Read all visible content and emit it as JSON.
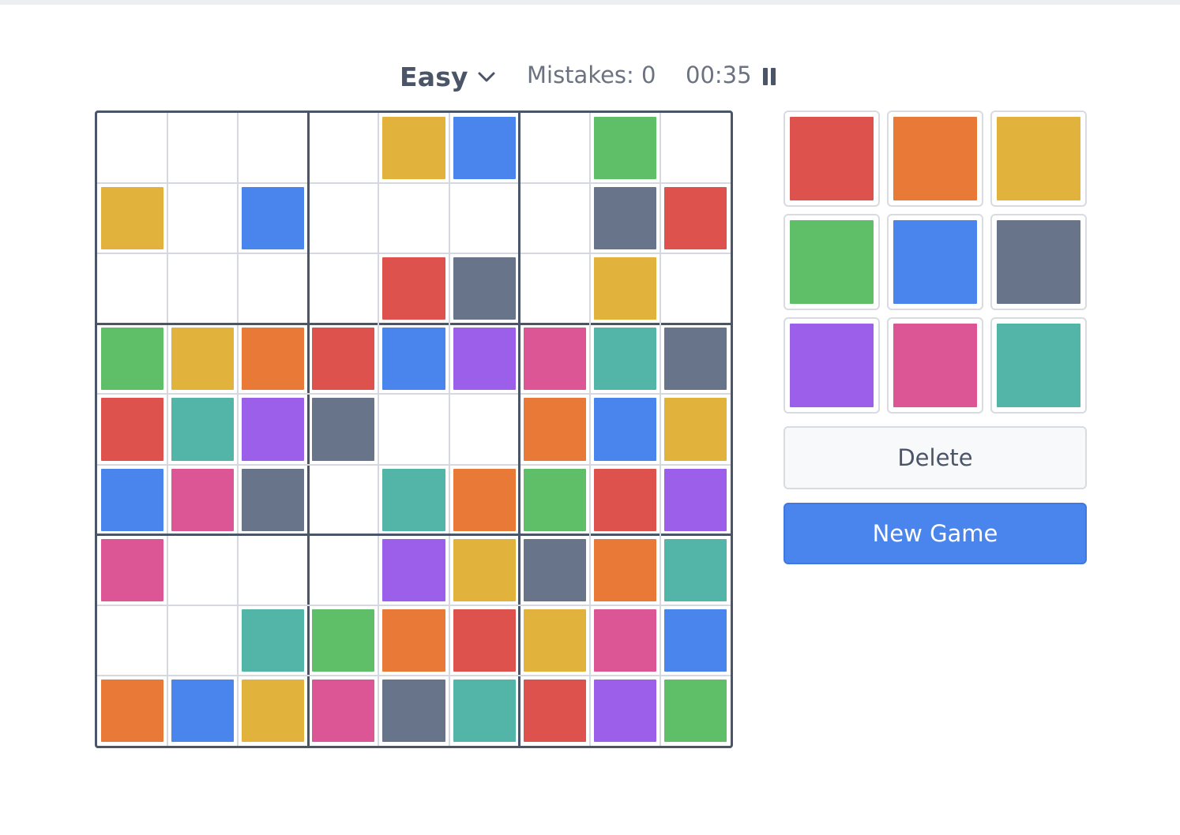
{
  "header": {
    "difficulty": "Easy",
    "mistakes_label": "Mistakes: 0",
    "timer": "00:35",
    "icons": [
      "chevron-down-icon",
      "pause-icon"
    ]
  },
  "colors": {
    "red": "#de524e",
    "orange": "#e87936",
    "yellow": "#e1b33d",
    "green": "#5fbf68",
    "blue": "#4a84ed",
    "slate": "#68748a",
    "purple": "#9b5fea",
    "pink": "#dc5696",
    "teal": "#53b5a7",
    "border": "#4a5568",
    "gridline": "#d5d8de"
  },
  "board": [
    [
      "",
      "",
      "",
      "",
      "yellow",
      "blue",
      "",
      "green",
      ""
    ],
    [
      "yellow",
      "",
      "blue",
      "",
      "",
      "",
      "",
      "slate",
      "red"
    ],
    [
      "",
      "",
      "",
      "",
      "red",
      "slate",
      "",
      "yellow",
      ""
    ],
    [
      "green",
      "yellow",
      "orange",
      "red",
      "blue",
      "purple",
      "pink",
      "teal",
      "slate"
    ],
    [
      "red",
      "teal",
      "purple",
      "slate",
      "",
      "",
      "orange",
      "blue",
      "yellow"
    ],
    [
      "blue",
      "pink",
      "slate",
      "",
      "teal",
      "orange",
      "green",
      "red",
      "purple"
    ],
    [
      "pink",
      "",
      "",
      "",
      "purple",
      "yellow",
      "slate",
      "orange",
      "teal"
    ],
    [
      "",
      "",
      "teal",
      "green",
      "orange",
      "red",
      "yellow",
      "pink",
      "blue"
    ],
    [
      "orange",
      "blue",
      "yellow",
      "pink",
      "slate",
      "teal",
      "red",
      "purple",
      "green"
    ]
  ],
  "palette": [
    "red",
    "orange",
    "yellow",
    "green",
    "blue",
    "slate",
    "purple",
    "pink",
    "teal"
  ],
  "buttons": {
    "delete_label": "Delete",
    "new_game_label": "New Game"
  }
}
